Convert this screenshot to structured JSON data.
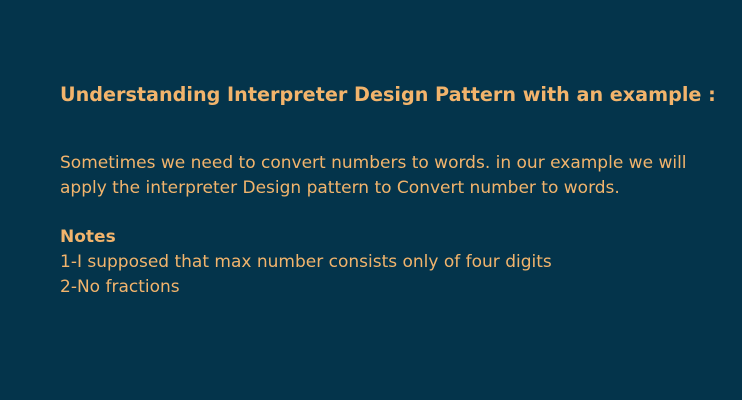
{
  "content": {
    "title": "Understanding Interpreter Design Pattern with an example :",
    "intro_lines": [
      "Sometimes we need to convert numbers to words. in our example we will",
      "apply the interpreter Design pattern to Convert number to words."
    ],
    "notes": {
      "heading": "Notes",
      "items": [
        "1-I supposed that max number consists only of four digits",
        "2-No fractions"
      ]
    }
  },
  "colors": {
    "background": "#04344b",
    "text": "#f2b46c"
  }
}
